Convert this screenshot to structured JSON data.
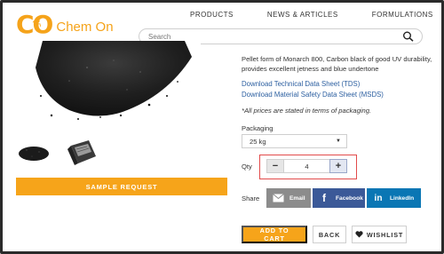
{
  "brand": {
    "logo_co": "CO",
    "logo_name": "Chem On",
    "accent": "#f6a41a"
  },
  "nav": {
    "items": [
      "PRODUCTS",
      "NEWS & ARTICLES",
      "FORMULATIONS"
    ]
  },
  "search": {
    "placeholder": "Search"
  },
  "product": {
    "description": "Pellet form of Monarch 800, Carbon black of good UV durability, provides excellent jetness and blue undertone",
    "links": [
      "Download Technical Data Sheet (TDS)",
      "Download Material Safety Data Sheet (MSDS)"
    ],
    "price_note": "*All prices are stated in terms of packaging.",
    "packaging_label": "Packaging",
    "packaging_value": "25 kg",
    "qty_label": "Qty",
    "qty_minus": "−",
    "qty_value": "4",
    "qty_plus": "+",
    "share_label": "Share",
    "share": {
      "email": "Email",
      "facebook": "Facebook",
      "linkedin": "LinkedIn"
    },
    "sample_request": "SAMPLE REQUEST",
    "add_to_cart": "ADD TO CART",
    "back": "BACK",
    "wishlist": "WISHLIST"
  },
  "icons": [
    "search-icon",
    "email-icon",
    "facebook-icon",
    "linkedin-icon",
    "heart-icon",
    "chevron-down-icon",
    "flask-icon"
  ]
}
